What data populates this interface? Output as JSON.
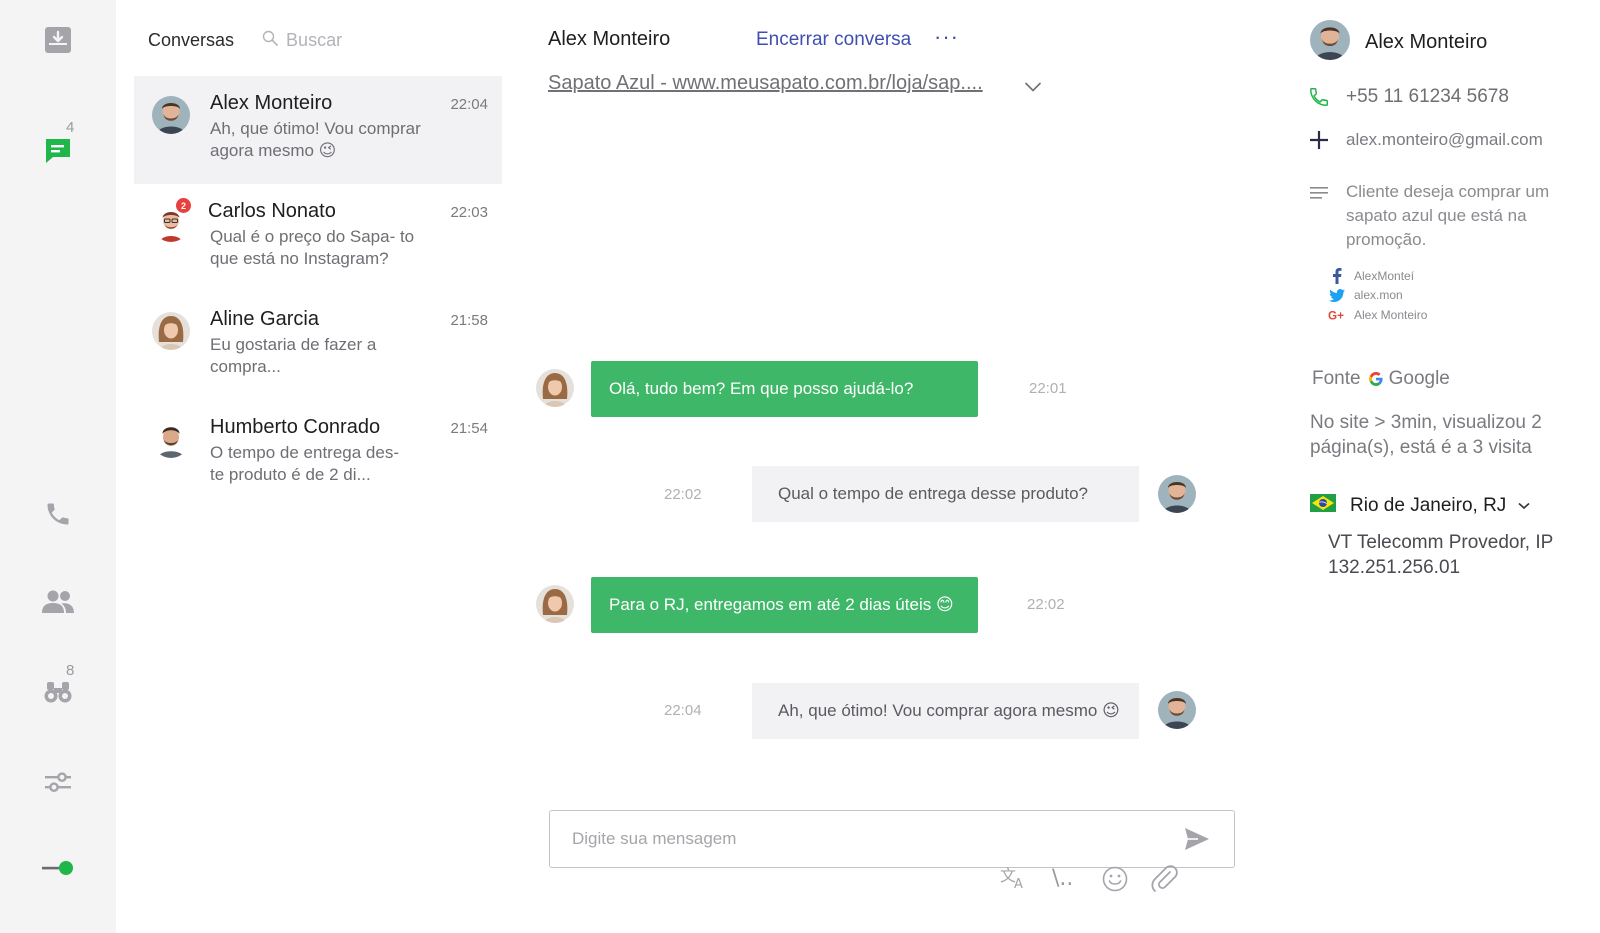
{
  "rail": {
    "chat_count": "4",
    "people_count": "8",
    "status_color": "#1fb64a"
  },
  "conversations": {
    "title": "Conversas",
    "search_placeholder": "Buscar",
    "items": [
      {
        "name": "Alex Monteiro",
        "time": "22:04",
        "snippet": "Ah, que ótimo! Vou comprar agora mesmo 😉",
        "active": true
      },
      {
        "name": "Carlos Nonato",
        "time": "22:03",
        "snippet": "Qual é o preço do Sapa- to que está no Instagram?",
        "badge": "2"
      },
      {
        "name": "Aline Garcia",
        "time": "21:58",
        "snippet": "Eu gostaria de fazer a compra..."
      },
      {
        "name": "Humberto Conrado",
        "time": "21:54",
        "snippet": "O tempo de entrega des- te produto é de 2 di..."
      }
    ]
  },
  "chat": {
    "contact_name": "Alex Monteiro",
    "end_label": "Encerrar conversa",
    "more_label": "···",
    "product_link": "Sapato Azul - www.meusapato.com.br/loja/sap....",
    "messages": [
      {
        "direction": "out",
        "text": "Olá, tudo bem? Em que posso ajudá-lo?",
        "time": "22:01"
      },
      {
        "direction": "in",
        "text": "Qual o tempo de entrega desse produto?",
        "time": "22:02"
      },
      {
        "direction": "out",
        "text": "Para o RJ, entregamos em até 2 dias úteis 😊",
        "time": "22:02"
      },
      {
        "direction": "in",
        "text": "Ah, que ótimo! Vou comprar agora mesmo 😉",
        "time": "22:04"
      }
    ],
    "composer_placeholder": "Digite sua mensagem",
    "shortcut_label": "\\..",
    "accent_color": "#3fb768"
  },
  "contact": {
    "name": "Alex Monteiro",
    "phone": "+55 11 61234 5678",
    "email": "alex.monteiro@gmail.com",
    "note": "Cliente deseja comprar um sapato azul que está na promoção.",
    "social": {
      "facebook": "AlexMonteí",
      "twitter": "alex.mon",
      "google": "Alex Monteiro"
    },
    "source_label": "Fonte",
    "source_value": "Google",
    "visit": "No site > 3min, visualizou 2 página(s), está é a 3 visita",
    "location": "Rio de Janeiro, RJ",
    "isp": "VT Telecomm Provedor, IP 132.251.256.01"
  }
}
